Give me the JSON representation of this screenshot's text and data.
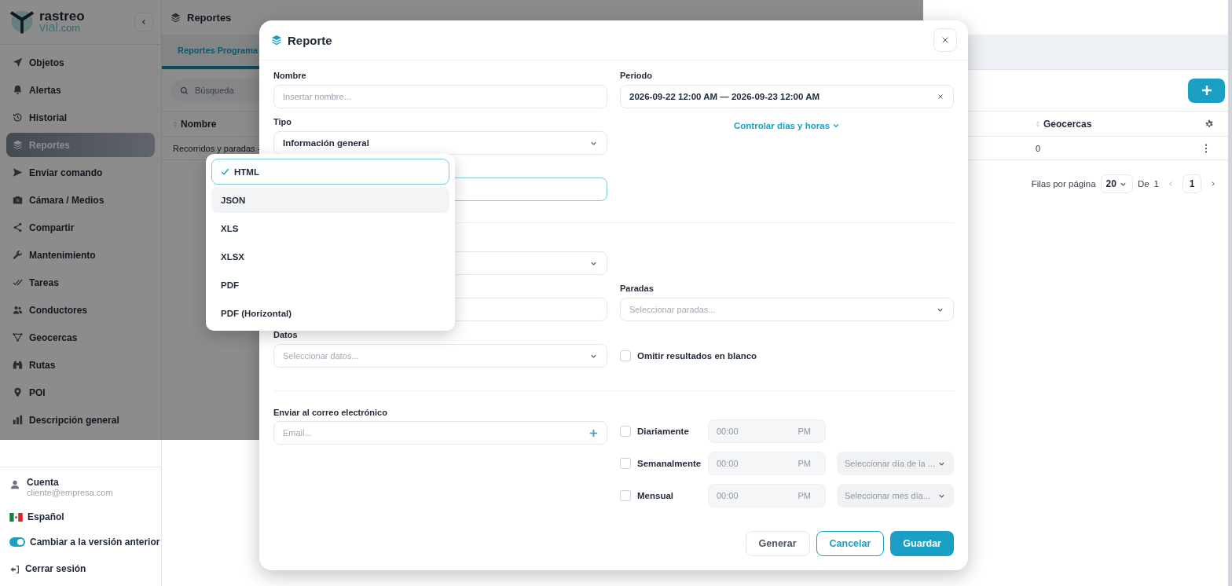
{
  "sidebar": {
    "logo": {
      "name": "rastreo",
      "domain": "vial",
      "tld": ".com"
    },
    "items": [
      {
        "label": "Objetos",
        "selected": false
      },
      {
        "label": "Alertas",
        "selected": false
      },
      {
        "label": "Historial",
        "selected": false
      },
      {
        "label": "Reportes",
        "selected": true
      },
      {
        "label": "Enviar comando",
        "selected": false
      },
      {
        "label": "Cámara / Medios",
        "selected": false
      },
      {
        "label": "Compartir",
        "selected": false
      },
      {
        "label": "Mantenimiento",
        "selected": false
      },
      {
        "label": "Tareas",
        "selected": false
      },
      {
        "label": "Conductores",
        "selected": false
      },
      {
        "label": "Geocercas",
        "selected": false
      },
      {
        "label": "Rutas",
        "selected": false
      },
      {
        "label": "POI",
        "selected": false
      },
      {
        "label": "Descripción general",
        "selected": false
      }
    ],
    "account": {
      "label": "Cuenta",
      "email": "cliente@empresa.com"
    },
    "language": "Español",
    "legacy_toggle": {
      "label": "Cambiar a la versión anterior",
      "on": true
    },
    "logout": "Cerrar sesión"
  },
  "page": {
    "title": "Reportes",
    "tabs": [
      {
        "label": "Reportes Programa",
        "selected": true
      }
    ],
    "search": {
      "placeholder": "Búsqueda"
    },
    "table": {
      "columns": [
        "Nombre",
        "Geocercas"
      ],
      "rows": [
        {
          "nombre": "Recorridos y paradas -",
          "geocercas": "0"
        }
      ]
    },
    "pagination": {
      "rows_label": "Filas por página",
      "rows_per_page": "20",
      "of_label": "De",
      "page_count": "1",
      "current_page": "1"
    }
  },
  "dialog": {
    "title": "Reporte",
    "name_field": {
      "label": "Nombre",
      "placeholder": "Insertar nombre..."
    },
    "type_field": {
      "label": "Tipo",
      "value": "Información general"
    },
    "format_field": {
      "open": true,
      "options": [
        {
          "label": "HTML",
          "selected": true,
          "highlighted": false
        },
        {
          "label": "JSON",
          "selected": false,
          "highlighted": true
        },
        {
          "label": "XLS",
          "selected": false,
          "highlighted": false
        },
        {
          "label": "XLSX",
          "selected": false,
          "highlighted": false
        },
        {
          "label": "PDF",
          "selected": false,
          "highlighted": false
        },
        {
          "label": "PDF (Horizontal)",
          "selected": false,
          "highlighted": false
        }
      ]
    },
    "period_field": {
      "label": "Periodo",
      "value": "2026-09-22 12:00 AM — 2026-09-23 12:00 AM"
    },
    "schedule_link": "Controlar días y horas",
    "stops_field": {
      "label": "Paradas",
      "placeholder": "Seleccionar paradas..."
    },
    "data_field": {
      "label": "Datos",
      "placeholder": "Seleccionar datos..."
    },
    "skip_blank": {
      "label": "Omitir resultados en blanco",
      "checked": false
    },
    "email_field": {
      "label": "Enviar al correo electrónico",
      "placeholder": "Email..."
    },
    "schedules": [
      {
        "kind": "daily",
        "label": "Diariamente",
        "checked": false,
        "time_placeholder": "00:00",
        "period": "PM"
      },
      {
        "kind": "weekly",
        "label": "Semanalmente",
        "checked": false,
        "time_placeholder": "00:00",
        "period": "PM",
        "day_placeholder": "Seleccionar día de la ..."
      },
      {
        "kind": "monthly",
        "label": "Mensual",
        "checked": false,
        "time_placeholder": "00:00",
        "period": "PM",
        "day_placeholder": "Seleccionar mes día..."
      }
    ],
    "buttons": [
      {
        "label": "Generar",
        "kind": "default"
      },
      {
        "label": "Cancelar",
        "kind": "outline"
      },
      {
        "label": "Guardar",
        "kind": "primary"
      }
    ]
  }
}
